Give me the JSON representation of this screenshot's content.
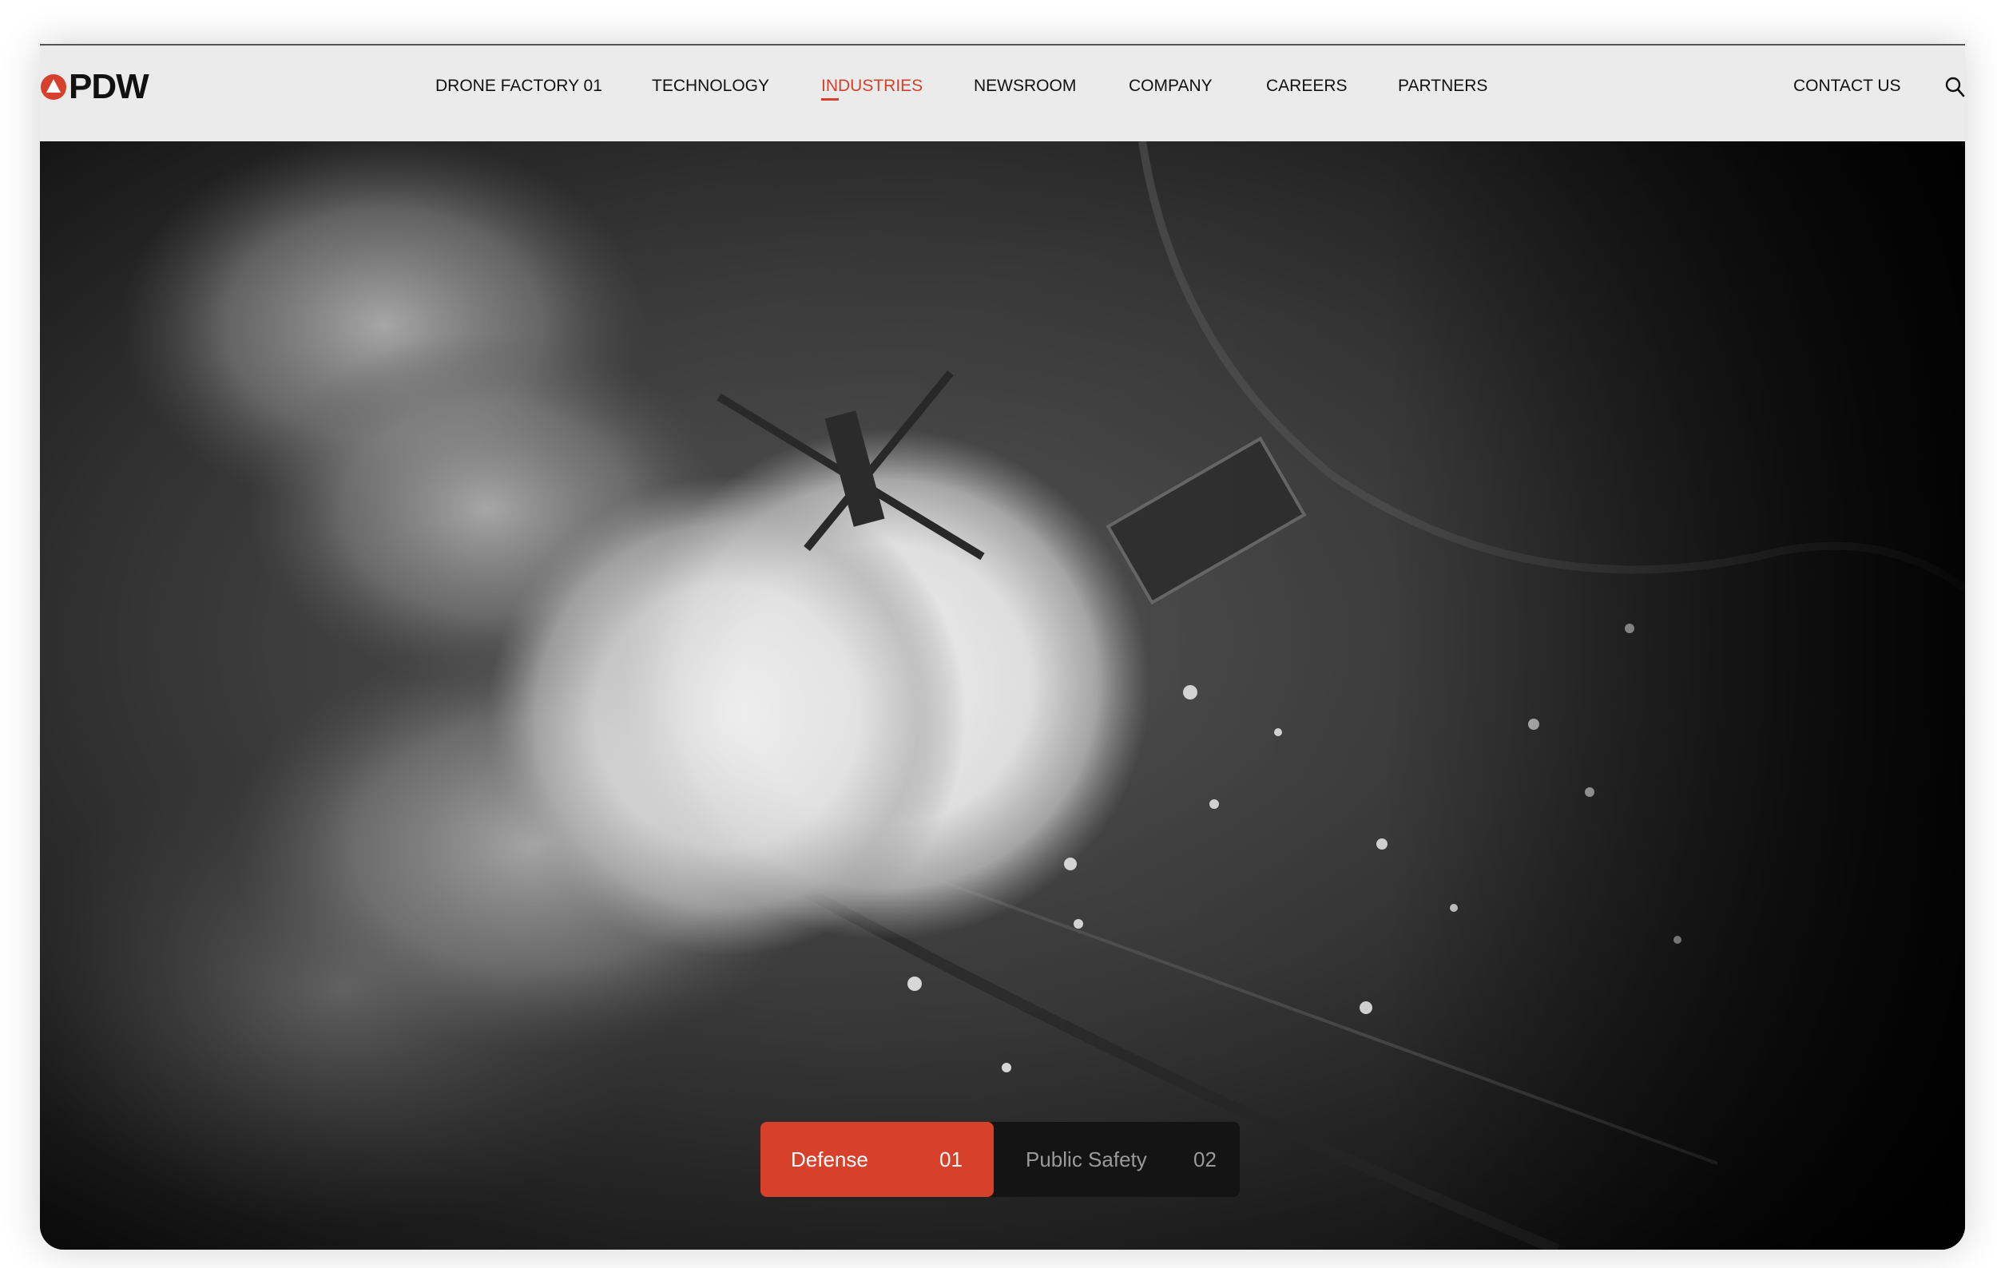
{
  "brand": {
    "name": "PDW",
    "accent": "#d7402b"
  },
  "nav": {
    "items": [
      {
        "label": "DRONE FACTORY 01"
      },
      {
        "label": "TECHNOLOGY"
      },
      {
        "label": "INDUSTRIES"
      },
      {
        "label": "NEWSROOM"
      },
      {
        "label": "COMPANY"
      },
      {
        "label": "CAREERS"
      },
      {
        "label": "PARTNERS"
      }
    ],
    "active_item": "INDUSTRIES",
    "contact_label": "CONTACT US",
    "search_icon": "search-icon"
  },
  "hero": {
    "tabs": [
      {
        "label": "Defense",
        "number": "01",
        "active": true
      },
      {
        "label": "Public Safety",
        "number": "02",
        "active": false
      }
    ]
  }
}
